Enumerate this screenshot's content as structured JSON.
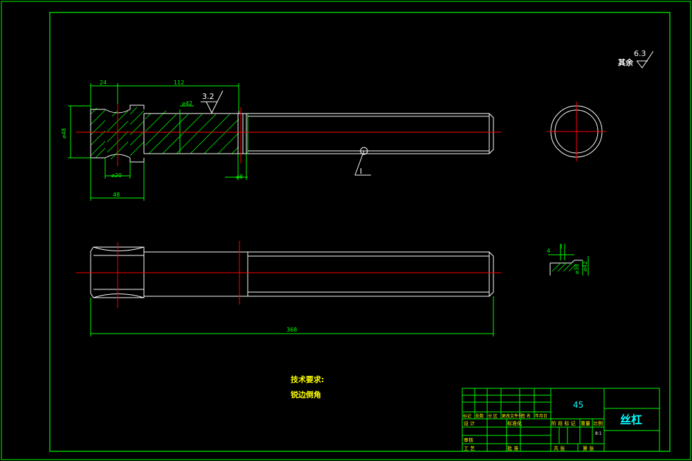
{
  "roughness": {
    "rest_label": "其余",
    "rest_value": "6.3",
    "local_value": "3.2"
  },
  "dimensions": {
    "d_24": "24",
    "d_112": "112",
    "d_phi42": "⌀42",
    "d_phi48": "⌀48",
    "d_phi20": "⌀20",
    "d_48": "48",
    "d_8": "⌀8",
    "d_368": "368"
  },
  "detail": {
    "marker": "I",
    "dim_4": "4",
    "dim_phi42": "⌀42",
    "dim_phi38": "⌀38"
  },
  "notes": {
    "title": "技术要求:",
    "line1": "锐边倒角"
  },
  "title_block": {
    "part_name": "丝杠",
    "material": "45",
    "row_headers": [
      "标记",
      "处数",
      "分 区",
      "更改文件号",
      "签 名",
      "年月日"
    ],
    "design_label": "设 计",
    "standard_label": "标准化",
    "stage_label": "阶 段 标 记",
    "weight_label": "重量",
    "scale_label": "比例",
    "scale_value": "8:1",
    "check_label": "审核",
    "process_label": "工 艺",
    "approve_label": "批 准",
    "sheets_total": "共  张",
    "sheet_no": "第  张"
  }
}
